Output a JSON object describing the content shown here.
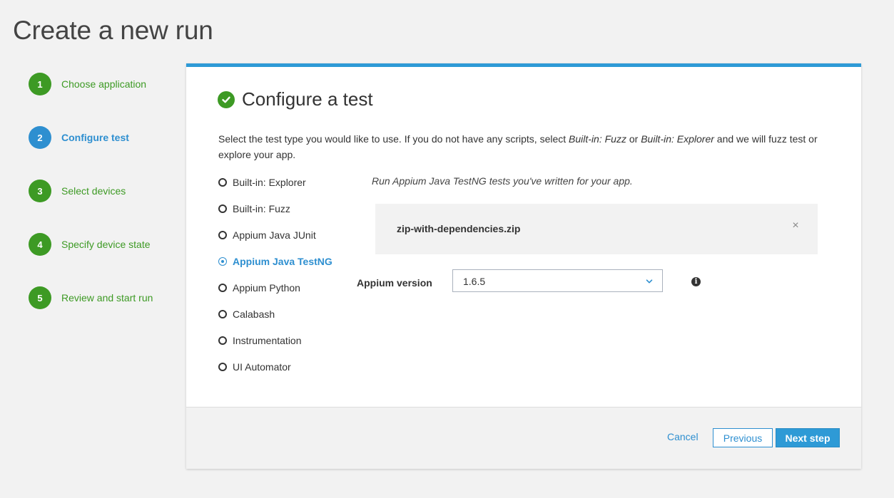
{
  "page": {
    "title": "Create a new run"
  },
  "steps": [
    {
      "number": "1",
      "label": "Choose application",
      "state": "done"
    },
    {
      "number": "2",
      "label": "Configure test",
      "state": "active"
    },
    {
      "number": "3",
      "label": "Select devices",
      "state": "done"
    },
    {
      "number": "4",
      "label": "Specify device state",
      "state": "done"
    },
    {
      "number": "5",
      "label": "Review and start run",
      "state": "done"
    }
  ],
  "panel": {
    "title": "Configure a test",
    "intro": {
      "part1": "Select the test type you would like to use. If you do not have any scripts, select ",
      "em1": "Built-in: Fuzz",
      "part2": " or ",
      "em2": "Built-in: Explorer",
      "part3": " and we will fuzz test or explore your app."
    },
    "test_types": [
      {
        "label": "Built-in: Explorer",
        "selected": false
      },
      {
        "label": "Built-in: Fuzz",
        "selected": false
      },
      {
        "label": "Appium Java JUnit",
        "selected": false
      },
      {
        "label": "Appium Java TestNG",
        "selected": true
      },
      {
        "label": "Appium Python",
        "selected": false
      },
      {
        "label": "Calabash",
        "selected": false
      },
      {
        "label": "Instrumentation",
        "selected": false
      },
      {
        "label": "UI Automator",
        "selected": false
      }
    ],
    "description": "Run Appium Java TestNG tests you've written for your app.",
    "file": {
      "name": "zip-with-dependencies.zip",
      "remove_symbol": "×"
    },
    "appium_version": {
      "label": "Appium version",
      "value": "1.6.5",
      "info_symbol": "i"
    }
  },
  "footer": {
    "cancel_label": "Cancel",
    "previous_label": "Previous",
    "next_label": "Next step"
  },
  "colors": {
    "accent_blue": "#2e8fd0",
    "success_green": "#3d9a24",
    "panel_top_border": "#2e9ad6"
  },
  "icons": {
    "heading": "check-circle-icon",
    "remove": "close-icon",
    "select": "chevron-down-icon",
    "info": "info-icon"
  }
}
